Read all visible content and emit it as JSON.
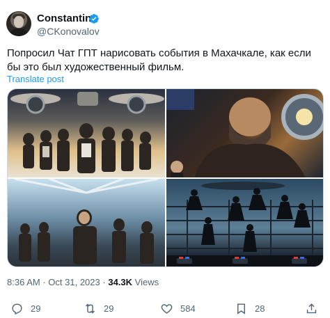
{
  "author": {
    "display_name": "Constantine",
    "handle": "@CKonovalov"
  },
  "tweet": {
    "text": "Попросил Чат ГПТ нарисовать события в Махачкале, как если бы это был художественный фильм.",
    "translate_label": "Translate post"
  },
  "meta": {
    "time": "8:36 AM",
    "separator": "·",
    "date": "Oct 31, 2023",
    "views_count": "34.3K",
    "views_label": "Views"
  },
  "actions": {
    "replies": "29",
    "reposts": "29",
    "likes": "584",
    "bookmarks": "28"
  },
  "colors": {
    "accent": "#1d9bf0",
    "text": "#0f1419",
    "muted": "#536471"
  }
}
